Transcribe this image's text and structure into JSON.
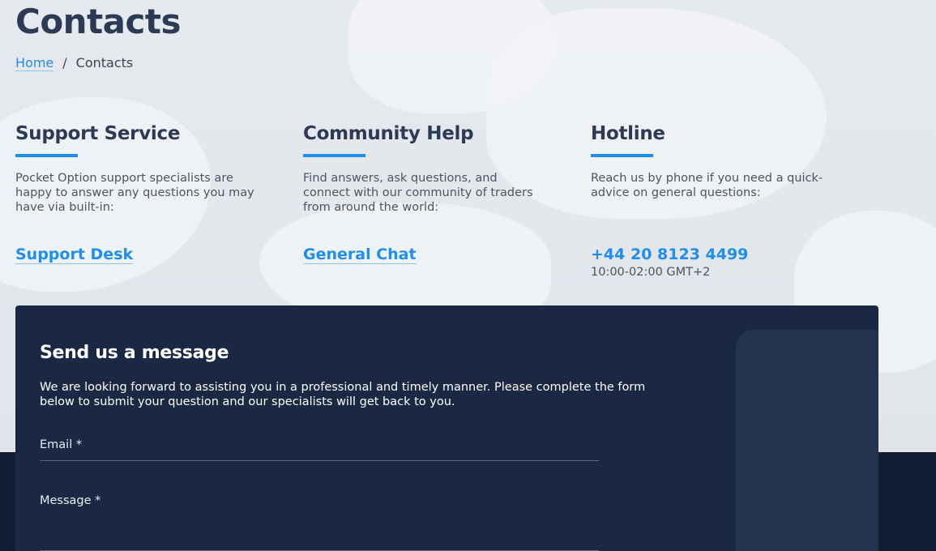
{
  "page": {
    "title": "Contacts"
  },
  "breadcrumb": {
    "home": "Home",
    "separator": "/",
    "current": "Contacts"
  },
  "columns": {
    "support": {
      "title": "Support Service",
      "text": "Pocket Option support specialists are happy to answer any questions you may have via built-in:",
      "link": "Support Desk"
    },
    "community": {
      "title": "Community Help",
      "text": "Find answers, ask questions, and connect with our community of traders from around the world:",
      "link": "General Chat"
    },
    "hotline": {
      "title": "Hotline",
      "text": "Reach us by phone if you need a quick-advice on general questions:",
      "phone": "+44 20 8123 4499",
      "hours": "10:00-02:00 GMT+2"
    }
  },
  "form": {
    "title": "Send us a message",
    "intro": "We are looking forward to assisting you in a professional and timely manner. Please complete the form below to submit your question and our specialists will get back to you.",
    "email_label": "Email *",
    "message_label": "Message *"
  },
  "colors": {
    "accent": "#1e8ef0",
    "heading": "#2d3a55",
    "card": "#1b2844",
    "footer": "#121f32"
  }
}
